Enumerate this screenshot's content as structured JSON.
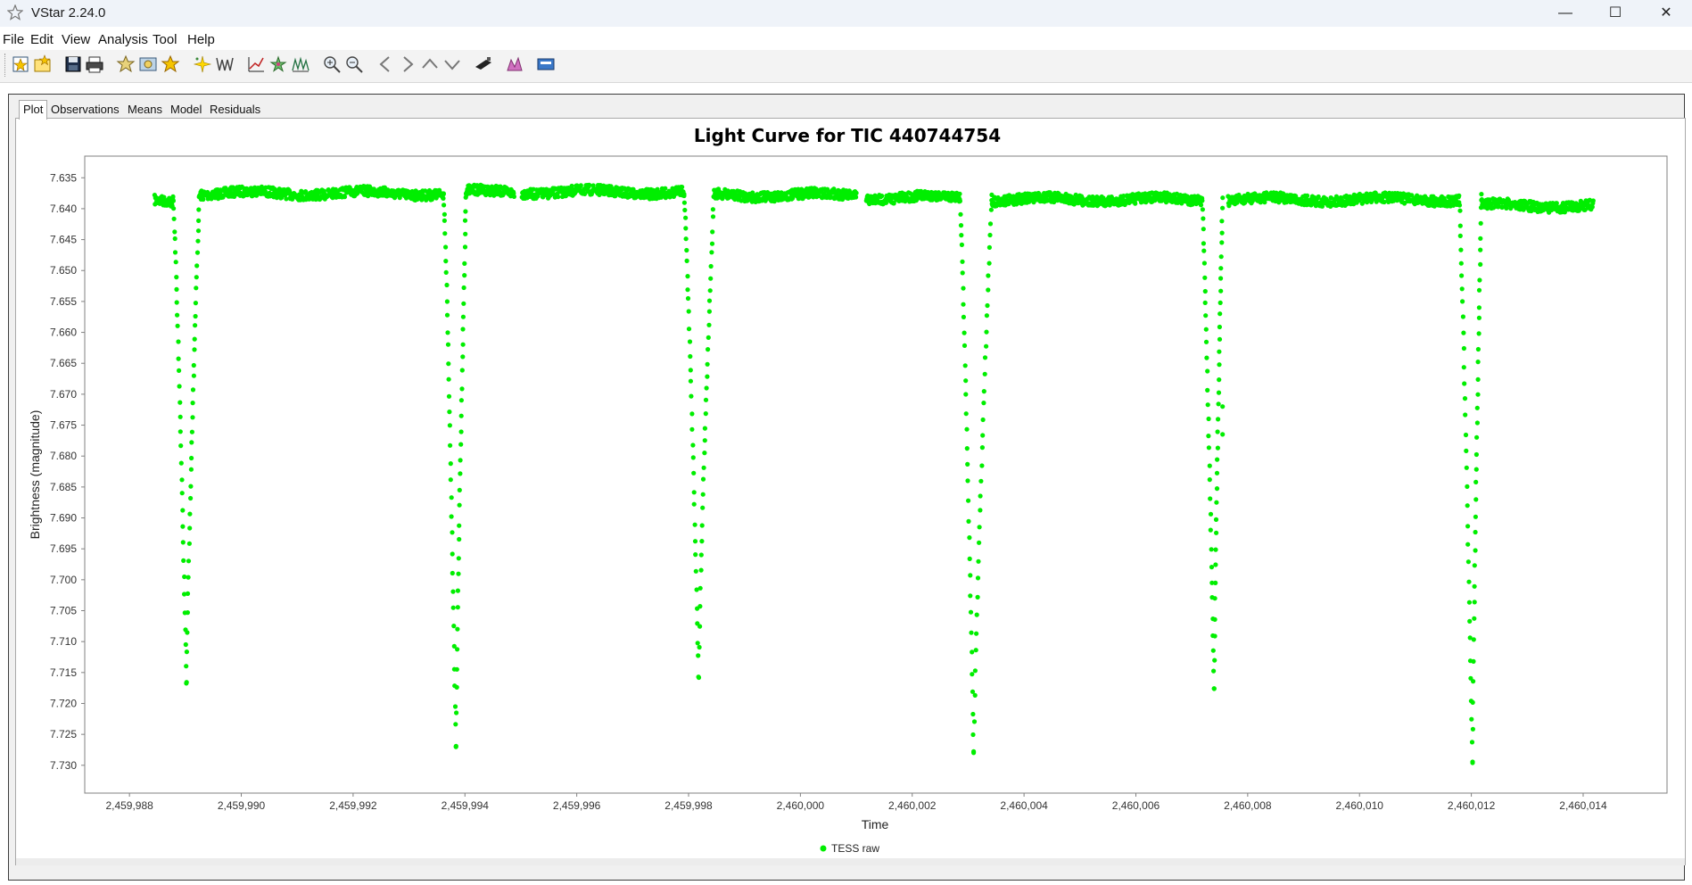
{
  "window": {
    "title": "VStar 2.24.0",
    "minimize_symbol": "—",
    "maximize_symbol": "☐",
    "close_symbol": "✕"
  },
  "menu": [
    "File",
    "Edit",
    "View",
    "Analysis",
    "Tool",
    "Help"
  ],
  "toolbar": {
    "buttons": [
      "new-star-icon",
      "open-star-icon",
      "save-icon",
      "print-icon",
      "obs-details-icon",
      "image-icon",
      "star-favorite-icon",
      "sparkle-icon",
      "wave-icon",
      "polyfit-icon",
      "model-star-icon",
      "fourier-icon",
      "zoom-in-icon",
      "zoom-out-icon",
      "pan-left-icon",
      "pan-right-icon",
      "pan-up-icon",
      "pan-down-icon",
      "filter-icon",
      "plugin-icon",
      "info-icon"
    ]
  },
  "tabs": [
    "Plot",
    "Observations",
    "Means",
    "Model",
    "Residuals"
  ],
  "active_tab": "Plot",
  "colors": {
    "series": "#00ee00",
    "plot_border": "#808080",
    "frame_bg": "#f0f0f0"
  },
  "chart_data": {
    "type": "scatter",
    "title": "Light Curve for TIC 440744754",
    "xlabel": "Time",
    "ylabel": "Brightness (magnitude)",
    "xlim": [
      2459987.2,
      2460015.5
    ],
    "ylim": [
      7.6315,
      7.7345
    ],
    "y_inverted": true,
    "x_ticks": [
      "2,459,988",
      "2,459,990",
      "2,459,992",
      "2,459,994",
      "2,459,996",
      "2,459,998",
      "2,460,000",
      "2,460,002",
      "2,460,004",
      "2,460,006",
      "2,460,008",
      "2,460,010",
      "2,460,012",
      "2,460,014"
    ],
    "x_tick_values": [
      2459988,
      2459990,
      2459992,
      2459994,
      2459996,
      2459998,
      2460000,
      2460002,
      2460004,
      2460006,
      2460008,
      2460010,
      2460012,
      2460014
    ],
    "y_ticks": [
      "7.635",
      "7.640",
      "7.645",
      "7.650",
      "7.655",
      "7.660",
      "7.665",
      "7.670",
      "7.675",
      "7.680",
      "7.685",
      "7.690",
      "7.695",
      "7.700",
      "7.705",
      "7.710",
      "7.715",
      "7.720",
      "7.725",
      "7.730"
    ],
    "y_tick_values": [
      7.635,
      7.64,
      7.645,
      7.65,
      7.655,
      7.66,
      7.665,
      7.67,
      7.675,
      7.68,
      7.685,
      7.69,
      7.695,
      7.7,
      7.705,
      7.71,
      7.715,
      7.72,
      7.725,
      7.73
    ],
    "legend_position": "bottom-center",
    "grid": false,
    "series": [
      {
        "name": "TESS raw",
        "baseline_segments": [
          {
            "x0": 2459988.45,
            "x1": 2459988.78,
            "y": 7.6388
          },
          {
            "x0": 2459989.25,
            "x1": 2459993.62,
            "y": 7.6375
          },
          {
            "x0": 2459994.02,
            "x1": 2459994.88,
            "y": 7.6373
          },
          {
            "x0": 2459995.02,
            "x1": 2459997.92,
            "y": 7.6373
          },
          {
            "x0": 2459998.45,
            "x1": 2460001.0,
            "y": 7.6378
          },
          {
            "x0": 2460001.18,
            "x1": 2460002.85,
            "y": 7.6382
          },
          {
            "x0": 2460003.42,
            "x1": 2460007.18,
            "y": 7.6385
          },
          {
            "x0": 2460007.65,
            "x1": 2460011.78,
            "y": 7.6385
          },
          {
            "x0": 2460012.18,
            "x1": 2460014.18,
            "y": 7.6395
          }
        ],
        "eclipses": [
          {
            "x_start": 2459988.78,
            "x_min": 2459989.02,
            "y_min": 7.7165,
            "x_end": 2459989.25
          },
          {
            "x_start": 2459993.62,
            "x_min": 2459993.84,
            "y_min": 7.727,
            "x_end": 2459994.02
          },
          {
            "x_start": 2459997.92,
            "x_min": 2459998.18,
            "y_min": 7.7155,
            "x_end": 2459998.45
          },
          {
            "x_start": 2460002.85,
            "x_min": 2460003.1,
            "y_min": 7.728,
            "x_end": 2460003.42
          },
          {
            "x_start": 2460007.18,
            "x_min": 2460007.4,
            "y_min": 7.7175,
            "x_end": 2460007.55
          },
          {
            "x_start": 2460011.78,
            "x_min": 2460012.02,
            "y_min": 7.7295,
            "x_end": 2460012.18
          }
        ],
        "extra_points": [
          {
            "x": 2460007.55,
            "y": 7.672
          },
          {
            "x": 2460007.55,
            "y": 7.6765
          }
        ]
      }
    ]
  }
}
